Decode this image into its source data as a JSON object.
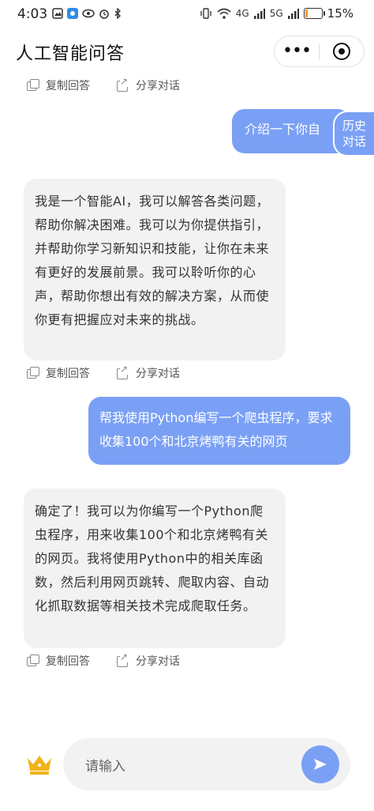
{
  "status": {
    "time": "4:03",
    "signal1": "4G",
    "signal2": "5G",
    "battery_percent": "15%",
    "battery_level": 0.15
  },
  "header": {
    "title": "人工智能问答"
  },
  "history_label": "历史\n对话",
  "actions": {
    "copy": "复制回答",
    "share": "分享对话"
  },
  "messages": [
    {
      "role": "user",
      "text": "介绍一下你自"
    },
    {
      "role": "bot",
      "text": "我是一个智能AI，我可以解答各类问题，帮助你解决困难。我可以为你提供指引，并帮助你学习新知识和技能，让你在未来有更好的发展前景。我可以聆听你的心声，帮助你想出有效的解决方案，从而使你更有把握应对未来的挑战。"
    },
    {
      "role": "user",
      "text": "帮我使用Python编写一个爬虫程序，要求收集100个和北京烤鸭有关的网页"
    },
    {
      "role": "bot",
      "text": "确定了！我可以为你编写一个Python爬虫程序，用来收集100个和北京烤鸭有关的网页。我将使用Python中的相关库函数，然后利用网页跳转、爬取内容、自动化抓取数据等相关技术完成爬取任务。"
    }
  ],
  "input": {
    "placeholder": "请输入"
  },
  "colors": {
    "accent": "#7aa0f5",
    "bot_bubble": "#f2f2f2",
    "crown": "#f3b21c"
  }
}
